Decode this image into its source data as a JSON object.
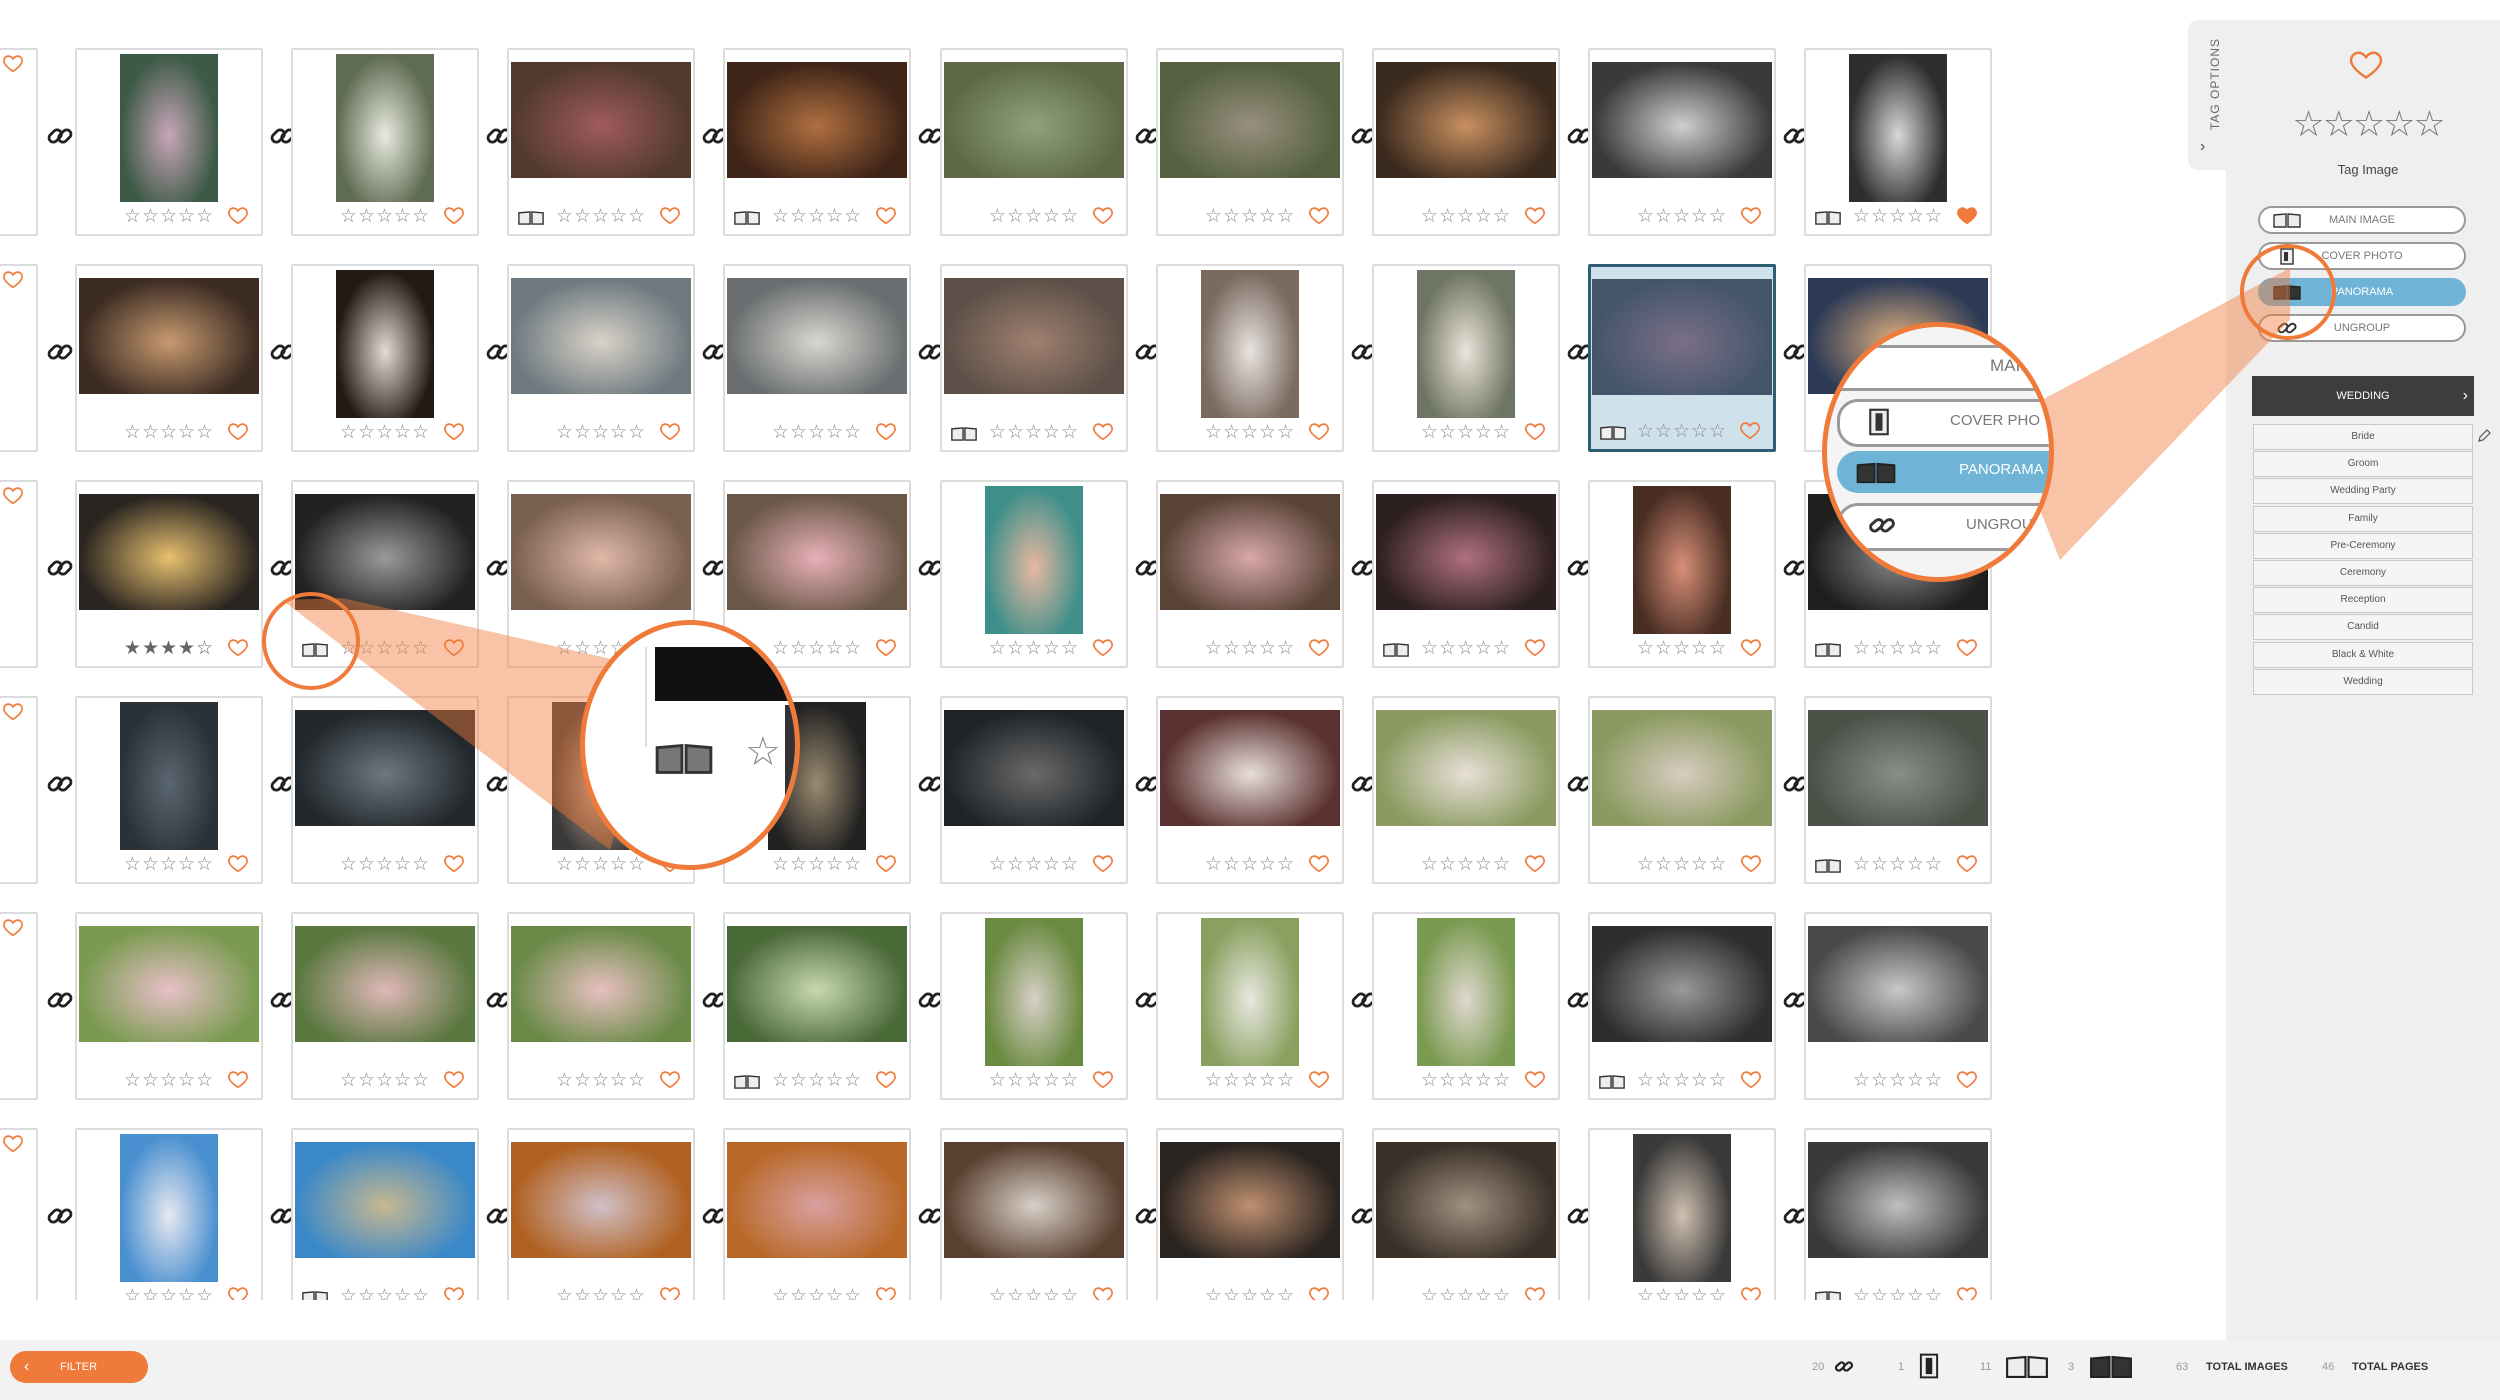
{
  "colors": {
    "accent": "#ef7a3a",
    "selected": "#6fb3d6",
    "dark": "#3d3d3d"
  },
  "rows": [
    [
      {
        "photo": "#3d5a47",
        "tone": "#c7a6b8",
        "book": false,
        "heart": "outline",
        "stars": 0,
        "portrait": true
      },
      {
        "photo": "#5f6b52",
        "tone": "#e8eadf",
        "book": false,
        "heart": "outline",
        "stars": 0,
        "portrait": true
      },
      {
        "photo": "#523a2e",
        "tone": "#a05a5e",
        "book": true,
        "heart": "outline",
        "stars": 0,
        "portrait": false
      },
      {
        "photo": "#3f2418",
        "tone": "#b07040",
        "book": true,
        "heart": "outline",
        "stars": 0,
        "portrait": false
      },
      {
        "photo": "#5e6847",
        "tone": "#8fa37a",
        "book": false,
        "heart": "outline",
        "stars": 0,
        "portrait": false
      },
      {
        "photo": "#54603f",
        "tone": "#98907e",
        "book": false,
        "heart": "outline",
        "stars": 0,
        "portrait": false
      },
      {
        "photo": "#3b2a1e",
        "tone": "#c89060",
        "book": false,
        "heart": "outline",
        "stars": 0,
        "portrait": false
      },
      {
        "photo": "#3a3a3a",
        "tone": "#cfcfcf",
        "book": false,
        "heart": "outline",
        "stars": 0,
        "portrait": false
      },
      {
        "photo": "#2e2e2e",
        "tone": "#d8d8d8",
        "book": true,
        "heart": "filled",
        "stars": 0,
        "portrait": true
      }
    ],
    [
      {
        "photo": "#3c2c23",
        "tone": "#c89a70",
        "book": false,
        "heart": "outline",
        "stars": 0,
        "portrait": false
      },
      {
        "photo": "#241a14",
        "tone": "#e3dcd2",
        "book": false,
        "heart": "outline",
        "stars": 0,
        "portrait": true
      },
      {
        "photo": "#6e7a80",
        "tone": "#d9d2c8",
        "book": false,
        "heart": "outline",
        "stars": 0,
        "portrait": false
      },
      {
        "photo": "#6a6e70",
        "tone": "#d8d8d0",
        "book": false,
        "heart": "outline",
        "stars": 0,
        "portrait": false
      },
      {
        "photo": "#5c5048",
        "tone": "#a08070",
        "book": true,
        "heart": "outline",
        "stars": 0,
        "portrait": false
      },
      {
        "photo": "#7a6a60",
        "tone": "#e9e4e0",
        "book": false,
        "heart": "outline",
        "stars": 0,
        "portrait": true
      },
      {
        "photo": "#6f7564",
        "tone": "#ebe4da",
        "book": false,
        "heart": "outline",
        "stars": 0,
        "portrait": true
      },
      {
        "photo": "#44556a",
        "tone": "#7a6f88",
        "book": true,
        "heart": "outline",
        "stars": 0,
        "portrait": false,
        "selected": true
      },
      {
        "photo": "#2c3a55",
        "tone": "#e0b080",
        "book": false,
        "heart": "outline",
        "stars": 0,
        "portrait": false
      }
    ],
    [
      {
        "photo": "#2a2520",
        "tone": "#e8c070",
        "book": false,
        "heart": "outline",
        "stars": 4,
        "portrait": false
      },
      {
        "photo": "#222222",
        "tone": "#9a9a9a",
        "book": true,
        "heart": "outline",
        "stars": 0,
        "portrait": false
      },
      {
        "photo": "#7a6050",
        "tone": "#e0b8a8",
        "book": false,
        "heart": "outline",
        "stars": 0,
        "portrait": false
      },
      {
        "photo": "#6b5848",
        "tone": "#e8b0b8",
        "book": false,
        "heart": "outline",
        "stars": 0,
        "portrait": false
      },
      {
        "photo": "#3e8f8a",
        "tone": "#e8b8a0",
        "book": false,
        "heart": "outline",
        "stars": 0,
        "portrait": true
      },
      {
        "photo": "#5a4438",
        "tone": "#d8a8a8",
        "book": false,
        "heart": "outline",
        "stars": 0,
        "portrait": false
      },
      {
        "photo": "#2d2020",
        "tone": "#b07080",
        "book": true,
        "heart": "outline",
        "stars": 0,
        "portrait": false
      },
      {
        "photo": "#4a2e24",
        "tone": "#d89078",
        "book": false,
        "heart": "outline",
        "stars": 0,
        "portrait": true
      },
      {
        "photo": "#1e1e1e",
        "tone": "#8a8a8a",
        "book": true,
        "heart": "outline",
        "stars": 0,
        "portrait": false
      }
    ],
    [
      {
        "photo": "#2a3238",
        "tone": "#5a6670",
        "book": false,
        "heart": "outline",
        "stars": 0,
        "portrait": true
      },
      {
        "photo": "#22282c",
        "tone": "#6e7880",
        "book": false,
        "heart": "outline",
        "stars": 0,
        "portrait": false
      },
      {
        "photo": "#3a3a3a",
        "tone": "#c8a890",
        "book": false,
        "heart": "outline",
        "stars": 0,
        "portrait": true
      },
      {
        "photo": "#222222",
        "tone": "#9a8a70",
        "book": false,
        "heart": "outline",
        "stars": 0,
        "portrait": true
      },
      {
        "photo": "#1f2428",
        "tone": "#6a6a6a",
        "book": false,
        "heart": "outline",
        "stars": 0,
        "portrait": false
      },
      {
        "photo": "#5a3030",
        "tone": "#e8e0d8",
        "book": false,
        "heart": "outline",
        "stars": 0,
        "portrait": false
      },
      {
        "photo": "#8a9a60",
        "tone": "#e8e0d8",
        "book": false,
        "heart": "outline",
        "stars": 0,
        "portrait": false
      },
      {
        "photo": "#8a9a60",
        "tone": "#d8ccc0",
        "book": false,
        "heart": "outline",
        "stars": 0,
        "portrait": false
      },
      {
        "photo": "#4a5248",
        "tone": "#888f88",
        "book": true,
        "heart": "outline",
        "stars": 0,
        "portrait": false
      }
    ],
    [
      {
        "photo": "#7a9a50",
        "tone": "#e8c0c8",
        "book": false,
        "heart": "outline",
        "stars": 0,
        "portrait": false
      },
      {
        "photo": "#5a7840",
        "tone": "#e0b8b8",
        "book": false,
        "heart": "outline",
        "stars": 0,
        "portrait": false
      },
      {
        "photo": "#6a8a48",
        "tone": "#e8c0c0",
        "book": false,
        "heart": "outline",
        "stars": 0,
        "portrait": false
      },
      {
        "photo": "#4a6a38",
        "tone": "#c8d8b0",
        "book": true,
        "heart": "outline",
        "stars": 0,
        "portrait": false
      },
      {
        "photo": "#6a8a40",
        "tone": "#d8d0c8",
        "book": false,
        "heart": "outline",
        "stars": 0,
        "portrait": true
      },
      {
        "photo": "#8aa060",
        "tone": "#e8e8e0",
        "book": false,
        "heart": "outline",
        "stars": 0,
        "portrait": true
      },
      {
        "photo": "#7a9a50",
        "tone": "#e0d8d0",
        "book": false,
        "heart": "outline",
        "stars": 0,
        "portrait": true
      },
      {
        "photo": "#2e2e2e",
        "tone": "#9a9a9a",
        "book": true,
        "heart": "outline",
        "stars": 0,
        "portrait": false
      },
      {
        "photo": "#4a4a4a",
        "tone": "#c8c8c8",
        "book": false,
        "heart": "outline",
        "stars": 0,
        "portrait": false
      }
    ],
    [
      {
        "photo": "#4a90d0",
        "tone": "#e8e8f0",
        "book": false,
        "heart": "outline",
        "stars": 0,
        "portrait": true
      },
      {
        "photo": "#3a88c8",
        "tone": "#c8b890",
        "book": true,
        "heart": "outline",
        "stars": 0,
        "portrait": false
      },
      {
        "photo": "#b06020",
        "tone": "#d0c0c8",
        "book": false,
        "heart": "outline",
        "stars": 0,
        "portrait": false
      },
      {
        "photo": "#b86828",
        "tone": "#d8a0a0",
        "book": false,
        "heart": "outline",
        "stars": 0,
        "portrait": false
      },
      {
        "photo": "#5a4030",
        "tone": "#d8d0c8",
        "book": false,
        "heart": "outline",
        "stars": 0,
        "portrait": false
      },
      {
        "photo": "#2a2420",
        "tone": "#c09070",
        "book": false,
        "heart": "outline",
        "stars": 0,
        "portrait": false
      },
      {
        "photo": "#3a3028",
        "tone": "#a09080",
        "book": false,
        "heart": "outline",
        "stars": 0,
        "portrait": false
      },
      {
        "photo": "#3a3a3a",
        "tone": "#d0c0b0",
        "book": false,
        "heart": "outline",
        "stars": 0,
        "portrait": true
      },
      {
        "photo": "#3a3a3a",
        "tone": "#c0c0c0",
        "book": true,
        "heart": "outline",
        "stars": 0,
        "portrait": false
      }
    ]
  ],
  "panel": {
    "tab_label": "TAG OPTIONS",
    "tab_chevron": "›",
    "heart": "heart-icon",
    "stars": "☆☆☆☆☆",
    "tag_image": "Tag Image",
    "buttons": [
      {
        "label": "MAIN IMAGE",
        "icon": "book-icon",
        "active": false
      },
      {
        "label": "COVER PHOTO",
        "icon": "cover-icon",
        "active": false
      },
      {
        "label": "PANORAMA",
        "icon": "panorama-icon",
        "active": true
      },
      {
        "label": "UNGROUP",
        "icon": "link-icon",
        "active": false
      }
    ],
    "wedding": "WEDDING",
    "wedding_chevron": "›",
    "categories": [
      "Bride",
      "Groom",
      "Wedding Party",
      "Family",
      "Pre-Ceremony",
      "Ceremony",
      "Reception",
      "Candid",
      "Black & White",
      "Wedding"
    ]
  },
  "zoom_right": {
    "main": "MAIN",
    "cover": "COVER PHO",
    "pano": "PANORAMA",
    "ungroup": "UNGROUI"
  },
  "bottom": {
    "filter": "FILTER",
    "filter_arrow": "‹",
    "links_count": "20",
    "cover_count": "1",
    "main_count": "11",
    "pano_count": "3",
    "total_images_count": "63",
    "total_images_label": "TOTAL IMAGES",
    "total_pages_count": "46",
    "total_pages_label": "TOTAL PAGES"
  }
}
